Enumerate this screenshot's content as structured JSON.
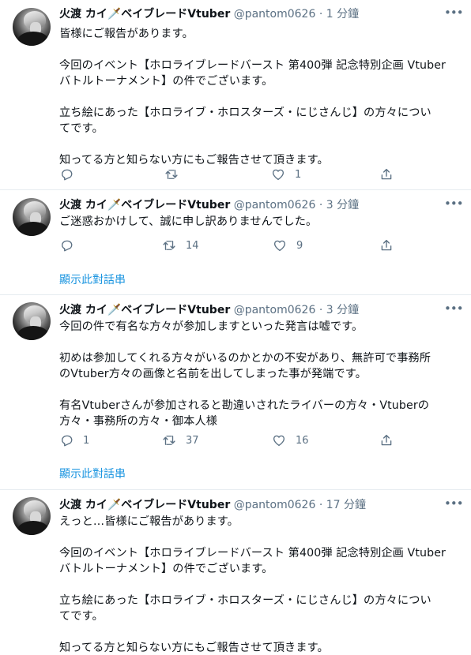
{
  "tweets": [
    {
      "display_name": "火渡 カイ🗡️ベイブレードVtuber",
      "handle": "@pantom0626",
      "time": "· 1 分鐘",
      "body": "皆様にご報告があります。\n\n今回のイベント【ホロライブレードバースト 第400弾 記念特別企画 Vtuber\nバトルトーナメント】の件でございます。\n\n立ち絵にあった【ホロライブ・ホロスターズ・にじさんじ】の方々につい\nてです。\n\n知ってる方と知らない方にもご報告させて頂きます。",
      "reply_count": "",
      "retweet_count": "",
      "like_count": "1",
      "show_thread": ""
    },
    {
      "display_name": "火渡 カイ🗡️ベイブレードVtuber",
      "handle": "@pantom0626",
      "time": "· 3 分鐘",
      "body": "ご迷惑おかけして、誠に申し訳ありませんでした。",
      "reply_count": "",
      "retweet_count": "14",
      "like_count": "9",
      "show_thread": "顯示此對話串"
    },
    {
      "display_name": "火渡 カイ🗡️ベイブレードVtuber",
      "handle": "@pantom0626",
      "time": "· 3 分鐘",
      "body": "今回の件で有名な方々が参加しますといった発言は嘘です。\n\n初めは参加してくれる方々がいるのかとかの不安があり、無許可で事務所\nのVtuber方々の画像と名前を出してしまった事が発端です。\n\n有名Vtuberさんが参加されると勘違いされたライバーの方々・Vtuberの\n方々・事務所の方々・御本人様",
      "reply_count": "1",
      "retweet_count": "37",
      "like_count": "16",
      "show_thread": "顯示此對話串"
    },
    {
      "display_name": "火渡 カイ🗡️ベイブレードVtuber",
      "handle": "@pantom0626",
      "time": "· 17 分鐘",
      "body": "えっと…皆様にご報告があります。\n\n今回のイベント【ホロライブレードバースト 第400弾 記念特別企画 Vtuber\nバトルトーナメント】の件でございます。\n\n立ち絵にあった【ホロライブ・ホロスターズ・にじさんじ】の方々につい\nてです。\n\n知ってる方と知らない方にもご報告させて頂きます。",
      "reply_count": "",
      "retweet_count": "",
      "like_count": "",
      "show_thread": ""
    }
  ],
  "icons": {
    "more": "more-icon",
    "reply": "reply-icon",
    "retweet": "retweet-icon",
    "like": "like-icon",
    "share": "share-icon"
  },
  "colors": {
    "text": "#0f1419",
    "muted": "#5b7083",
    "link": "#1b95e0",
    "divider": "#e6ecf0"
  }
}
